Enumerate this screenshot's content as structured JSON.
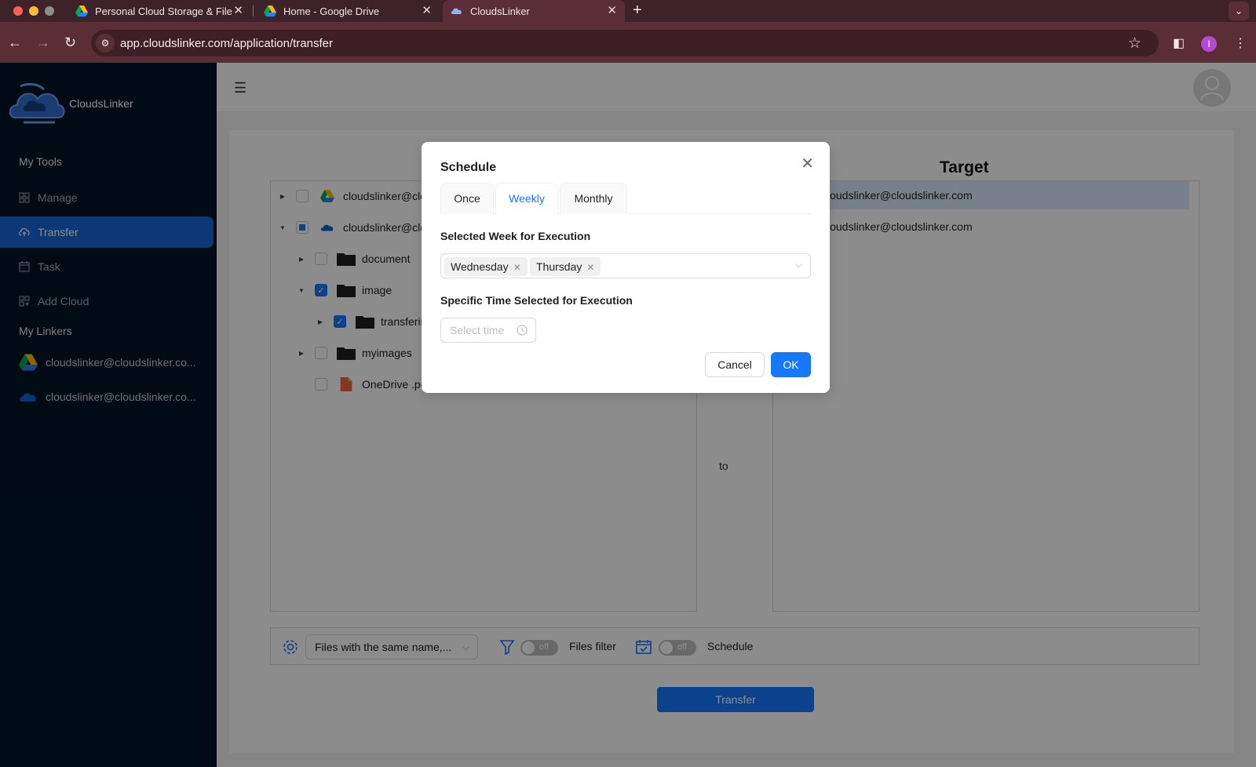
{
  "browser": {
    "tabs": [
      {
        "title": "Personal Cloud Storage & File",
        "icon": "google-drive-icon"
      },
      {
        "title": "Home - Google Drive",
        "icon": "google-drive-icon"
      },
      {
        "title": "CloudsLinker",
        "icon": "cloudslinker-icon"
      }
    ],
    "url": "app.cloudslinker.com/application/transfer",
    "profile_initial": "I"
  },
  "sidebar": {
    "brand": "CloudsLinker",
    "my_tools_label": "My Tools",
    "items": [
      {
        "label": "Manage",
        "icon": "grid-icon"
      },
      {
        "label": "Transfer",
        "icon": "cloud-transfer-icon"
      },
      {
        "label": "Task",
        "icon": "calendar-icon"
      },
      {
        "label": "Add Cloud",
        "icon": "grid-add-icon"
      }
    ],
    "my_linkers_label": "My Linkers",
    "linkers": [
      {
        "label": "cloudslinker@cloudslinker.co...",
        "icon": "google-drive-icon"
      },
      {
        "label": "cloudslinker@cloudslinker.co...",
        "icon": "onedrive-icon"
      }
    ]
  },
  "source": {
    "rows": [
      {
        "label": "cloudslinker@clo",
        "kind": "drive"
      },
      {
        "label": "cloudslinker@clo",
        "kind": "onedrive"
      },
      {
        "label": "document",
        "kind": "folder"
      },
      {
        "label": "image",
        "kind": "folder"
      },
      {
        "label": "transferin",
        "kind": "folder"
      },
      {
        "label": "myimages",
        "kind": "folder"
      },
      {
        "label": "OneDrive .pd",
        "kind": "pdf"
      }
    ]
  },
  "target": {
    "title": "Target",
    "rows": [
      {
        "label": "cloudslinker@cloudslinker.com"
      },
      {
        "label": "cloudslinker@cloudslinker.com"
      }
    ]
  },
  "to_label": "to",
  "options": {
    "conflict_select": "Files with the same name,...",
    "filter_switch": "off",
    "filter_label": "Files filter",
    "schedule_switch": "off",
    "schedule_label": "Schedule"
  },
  "transfer_button": "Transfer",
  "modal": {
    "title": "Schedule",
    "tabs": [
      "Once",
      "Weekly",
      "Monthly"
    ],
    "active_tab": "Weekly",
    "week_label": "Selected Week for Execution",
    "selected_days": [
      "Wednesday",
      "Thursday"
    ],
    "time_label": "Specific Time Selected for Execution",
    "time_placeholder": "Select time",
    "cancel": "Cancel",
    "ok": "OK"
  },
  "colors": {
    "primary": "#1677ff",
    "sidebar_bg": "#001529",
    "sidebar_active": "#1669d6"
  }
}
